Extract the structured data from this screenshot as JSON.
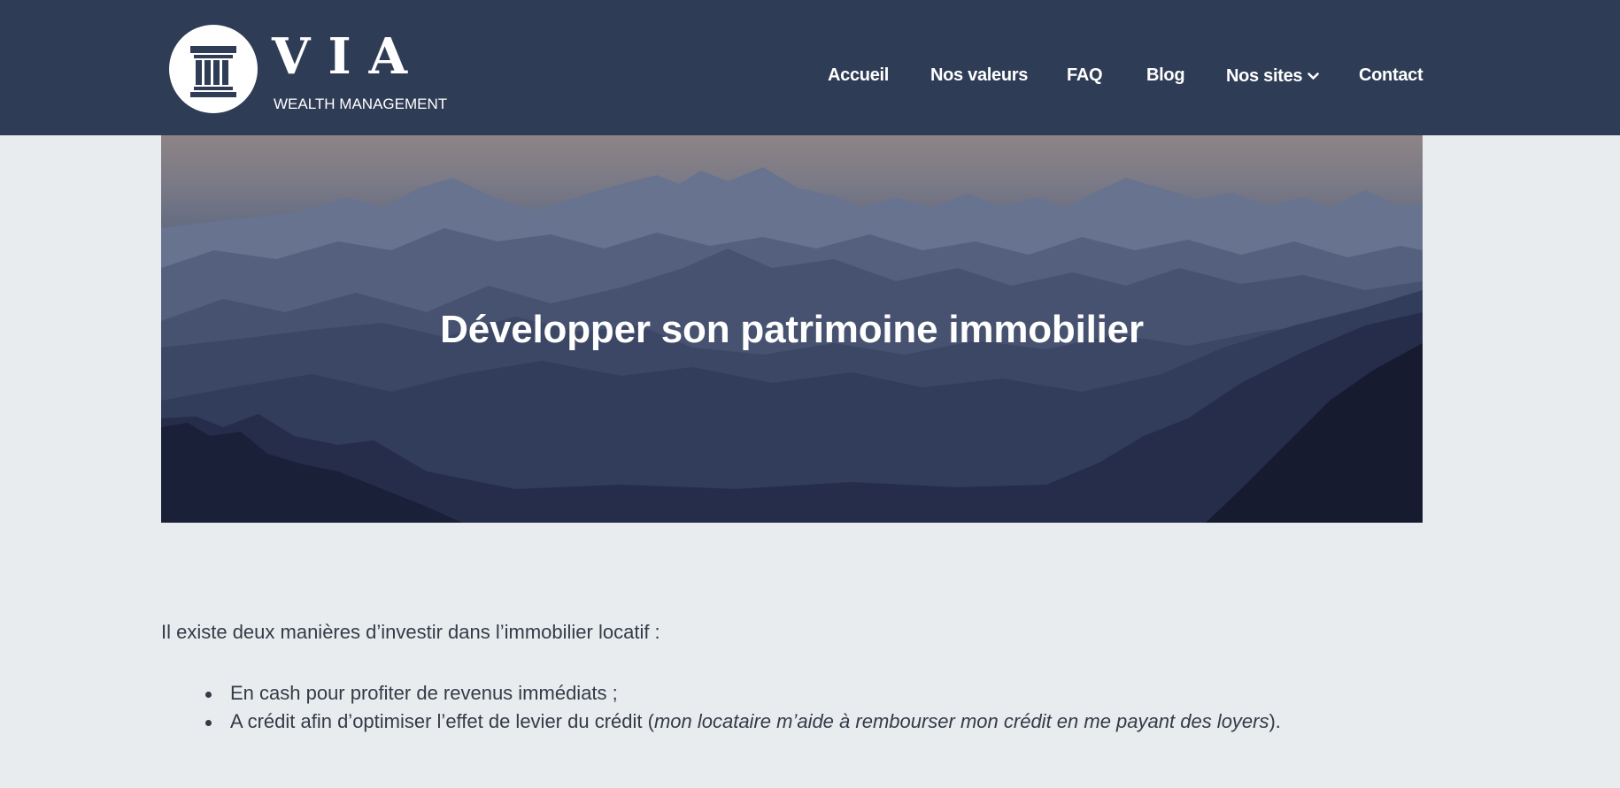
{
  "header": {
    "logo": {
      "title": "VIA",
      "subtitle": "WEALTH MANAGEMENT"
    },
    "nav": [
      {
        "label": "Accueil"
      },
      {
        "label": "Nos valeurs"
      },
      {
        "label": "FAQ"
      },
      {
        "label": "Blog"
      },
      {
        "label": "Nos sites",
        "icon": "chevron-down-icon"
      },
      {
        "label": "Contact"
      }
    ]
  },
  "hero": {
    "title": "Développer son patrimoine immobilier"
  },
  "content": {
    "intro": "Il existe deux manières d’investir dans l’immobilier locatif :",
    "bullets": [
      {
        "text": "En cash pour profiter de revenus immédiats ;"
      },
      {
        "prefix": "A crédit afin d’optimiser l’effet de levier du crédit (",
        "italic": "mon locataire m’aide à rembourser mon crédit en me payant des loyers",
        "suffix": ")."
      }
    ]
  },
  "colors": {
    "header_bg": "#2f3c55",
    "page_bg": "#e8ecef",
    "text": "#353a47",
    "nav_text": "#ffffff"
  }
}
